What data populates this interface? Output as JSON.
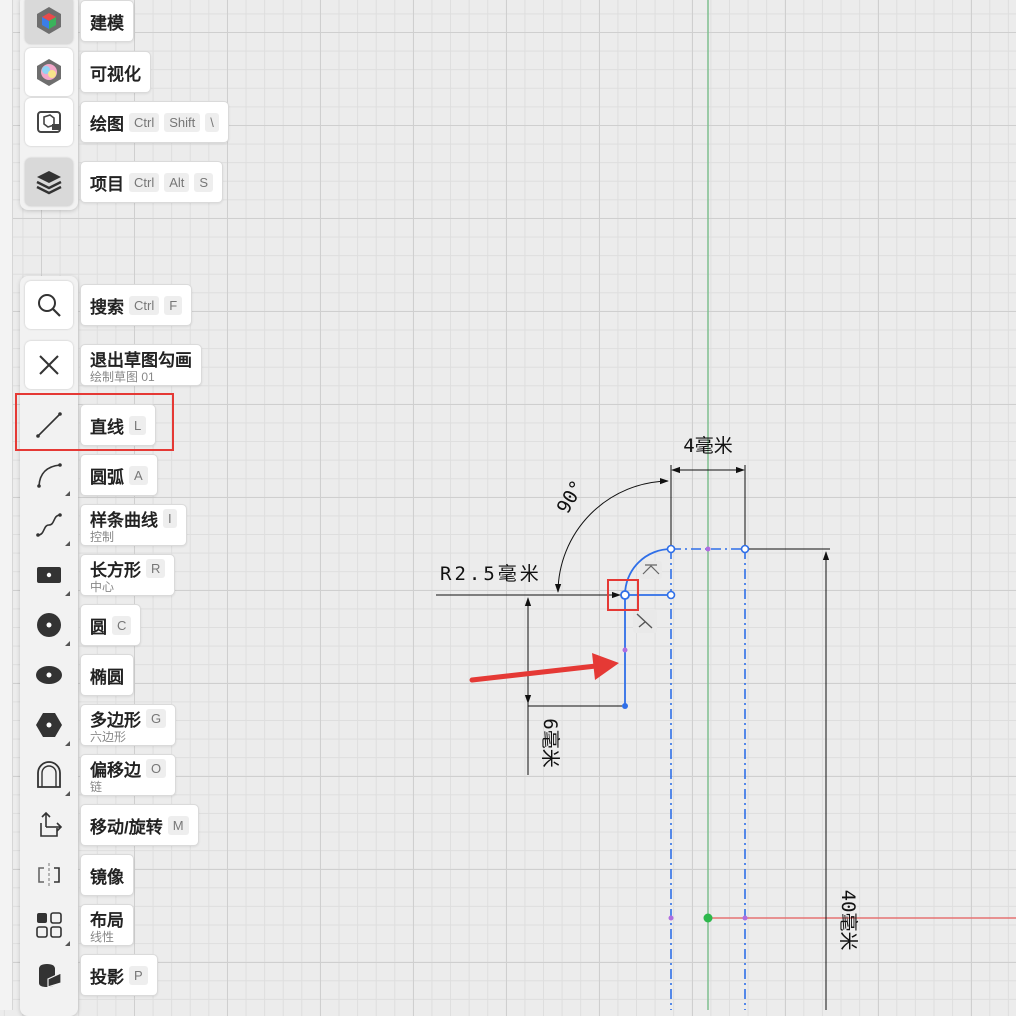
{
  "workspaces": [
    {
      "name": "建模"
    },
    {
      "name": "可视化"
    },
    {
      "name": "绘图",
      "keys": [
        "Ctrl",
        "Shift",
        "\\"
      ]
    },
    {
      "name": "项目",
      "keys": [
        "Ctrl",
        "Alt",
        "S"
      ]
    }
  ],
  "tools": {
    "search": {
      "label": "搜索",
      "keys": [
        "Ctrl",
        "F"
      ]
    },
    "exit": {
      "label": "退出草图勾画",
      "sub": "绘制草图 01"
    },
    "line": {
      "label": "直线",
      "key": "L"
    },
    "arc": {
      "label": "圆弧",
      "key": "A"
    },
    "spline": {
      "label": "样条曲线",
      "key": "I",
      "sub": "控制"
    },
    "rect": {
      "label": "长方形",
      "key": "R",
      "sub": "中心"
    },
    "circle": {
      "label": "圆",
      "key": "C"
    },
    "ellipse": {
      "label": "椭圆"
    },
    "polygon": {
      "label": "多边形",
      "key": "G",
      "sub": "六边形"
    },
    "offset": {
      "label": "偏移边",
      "key": "O",
      "sub": "链"
    },
    "move": {
      "label": "移动/旋转",
      "key": "M"
    },
    "mirror": {
      "label": "镜像"
    },
    "layout": {
      "label": "布局",
      "sub": "线性"
    },
    "project": {
      "label": "投影",
      "key": "P"
    }
  },
  "dimensions": {
    "width_top": "4毫米",
    "angle": "90°",
    "radius": "R2.5毫米",
    "height_small": "6毫米",
    "height_total": "40毫米"
  },
  "colors": {
    "sketch_line": "#2f6fe8",
    "axis_green": "#7fbf8f",
    "axis_red": "#e57373",
    "highlight": "#e53935",
    "arrow": "#e53935",
    "origin": "#2db84c",
    "construction_point": "#b06ee0"
  },
  "icons": [
    "model-cube-icon",
    "visualize-icon",
    "drawing-icon",
    "layers-icon",
    "search-icon",
    "close-icon",
    "line-icon",
    "arc-icon",
    "spline-icon",
    "rectangle-icon",
    "circle-icon",
    "ellipse-icon",
    "polygon-icon",
    "offset-edge-icon",
    "move-rotate-icon",
    "mirror-icon",
    "layout-icon",
    "projection-icon"
  ]
}
